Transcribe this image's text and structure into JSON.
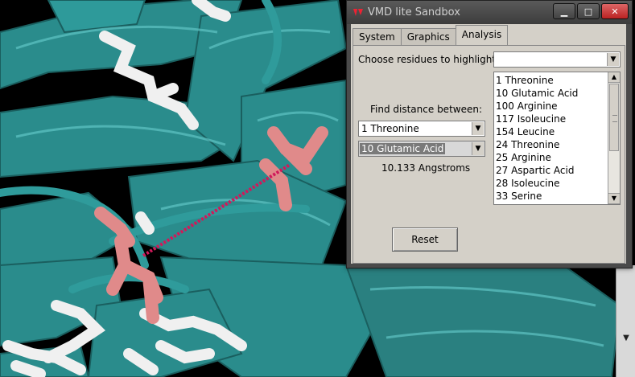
{
  "window": {
    "title": "VMD lite Sandbox",
    "minimize": "▁",
    "maximize": "□",
    "close": "✕"
  },
  "tabs": [
    {
      "label": "System"
    },
    {
      "label": "Graphics"
    },
    {
      "label": "Analysis"
    }
  ],
  "analysis": {
    "highlight_label": "Choose residues to highlight:",
    "highlight_value": "",
    "distance_label": "Find distance between:",
    "residue_a": "1 Threonine",
    "residue_b": "10 Glutamic Acid",
    "distance_result": "10.133 Angstroms",
    "reset_label": "Reset",
    "residue_list": [
      "1 Threonine",
      "10 Glutamic Acid",
      "100 Arginine",
      "117 Isoleucine",
      "154 Leucine",
      "24 Threonine",
      "25 Arginine",
      "27 Aspartic Acid",
      "28 Isoleucine",
      "33 Serine"
    ]
  },
  "colors": {
    "protein": "#2a8c8c",
    "highlight_residue": "#e08a8a",
    "residue": "#e6e6e6",
    "distance_line": "#d0195a"
  },
  "icons": {
    "app": "vmd-logo-icon",
    "combo_arrow": "▼",
    "scroll_up": "▲",
    "scroll_down": "▼"
  }
}
